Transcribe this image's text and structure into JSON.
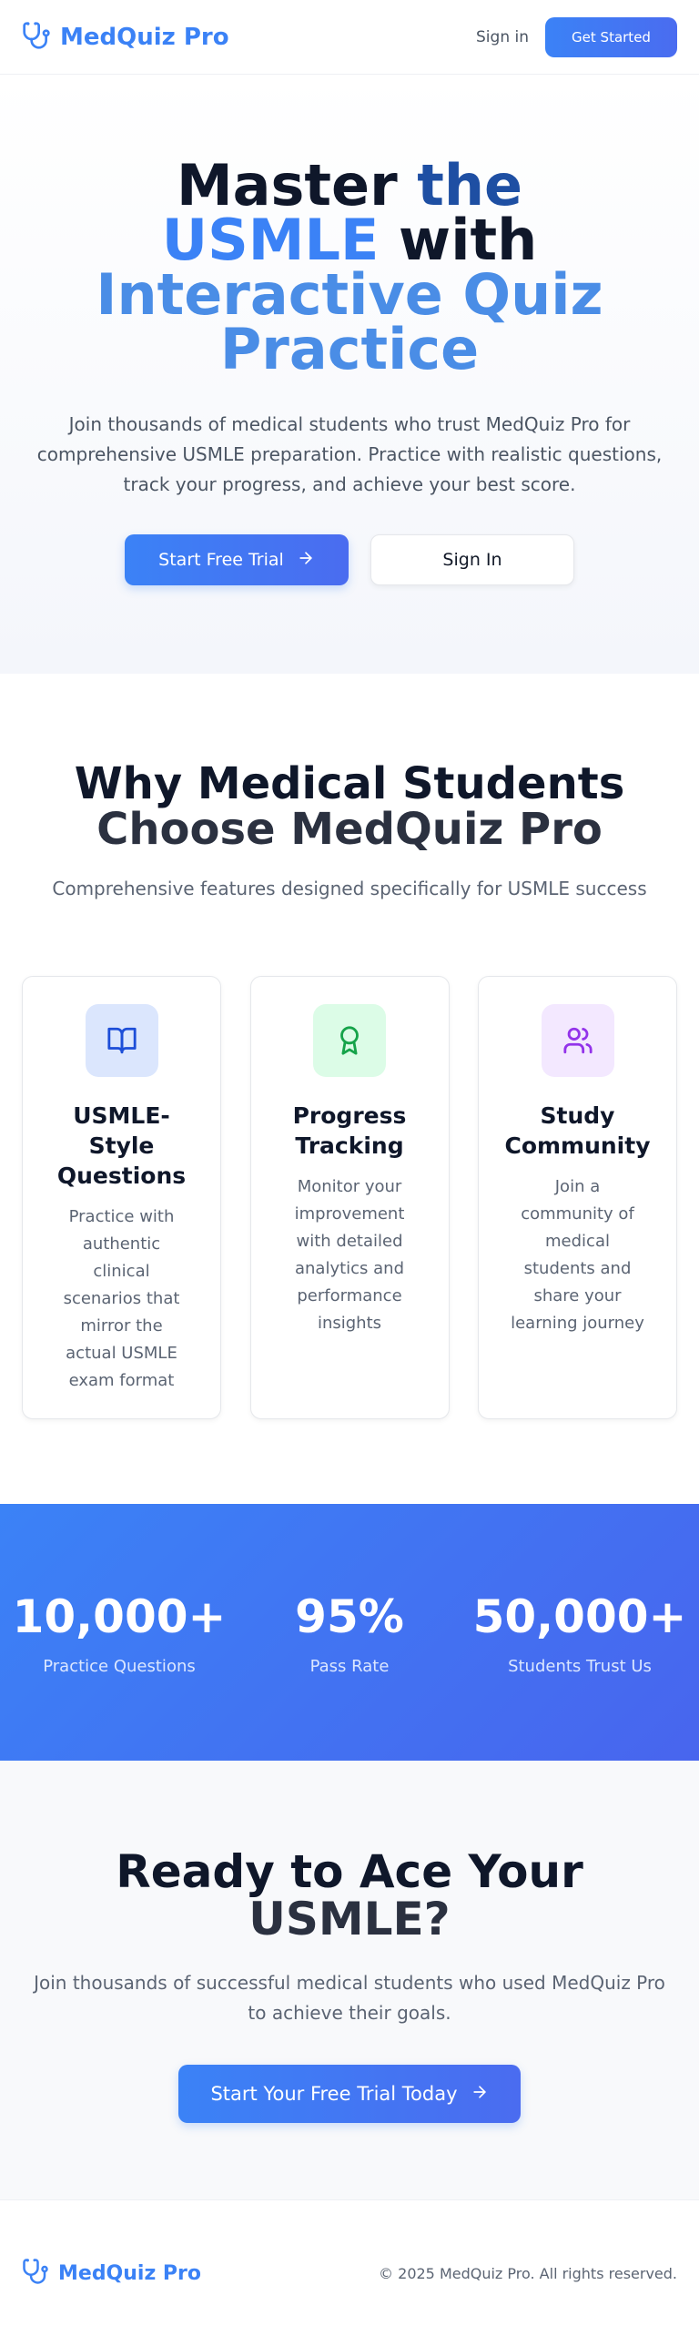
{
  "header": {
    "brand": "MedQuiz Pro",
    "icon": "stethoscope-icon",
    "sign_in": "Sign in",
    "get_started": "Get Started"
  },
  "hero": {
    "title_part1": "Master",
    "title_part2": "the",
    "title_part3": "USMLE",
    "title_part4": "with",
    "title_part5": "Interactive Quiz Practice",
    "subtitle": "Join thousands of medical students who trust MedQuiz Pro for comprehensive USMLE preparation. Practice with realistic questions, track your progress, and achieve your best score.",
    "primary_button": "Start Free Trial",
    "secondary_button": "Sign In"
  },
  "features": {
    "title_line1": "Why Medical Students",
    "title_line2": "Choose MedQuiz Pro",
    "subtitle": "Comprehensive features designed specifically for USMLE success",
    "cards": [
      {
        "icon": "book-open-icon",
        "title": "USMLE-Style Questions",
        "description": "Practice with authentic clinical scenarios that mirror the actual USMLE exam format"
      },
      {
        "icon": "award-icon",
        "title": "Progress Tracking",
        "description": "Monitor your improvement with detailed analytics and performance insights"
      },
      {
        "icon": "users-icon",
        "title": "Study Community",
        "description": "Join a community of medical students and share your learning journey"
      }
    ]
  },
  "stats": [
    {
      "value": "10,000+",
      "label": "Practice Questions"
    },
    {
      "value": "95%",
      "label": "Pass Rate"
    },
    {
      "value": "50,000+",
      "label": "Students Trust Us"
    }
  ],
  "cta": {
    "title_line1": "Ready to Ace Your",
    "title_line2": "USMLE?",
    "subtitle": "Join thousands of successful medical students who used MedQuiz Pro to achieve their goals.",
    "button": "Start Your Free Trial Today"
  },
  "footer": {
    "brand": "MedQuiz Pro",
    "copyright": "© 2025 MedQuiz Pro. All rights reserved."
  },
  "colors": {
    "brand_blue": "#3b82f6",
    "gradient_end": "#4a6cf0",
    "green_icon": "#16a34a",
    "purple_icon": "#9333ea"
  }
}
